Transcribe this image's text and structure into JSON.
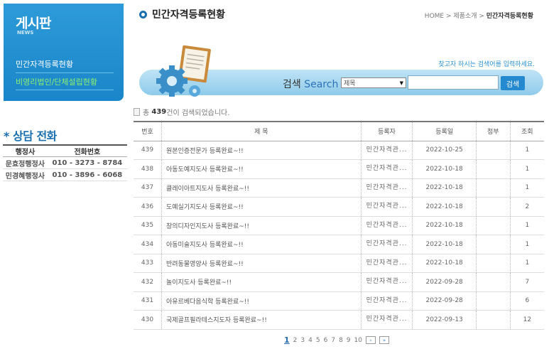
{
  "sidebar": {
    "title": "게시판",
    "subtitle": "NEWS",
    "items": [
      {
        "label": "민간자격등록현황"
      },
      {
        "label": "비영리법인/단체설립현황"
      }
    ]
  },
  "consult": {
    "title": "* 상담 전화",
    "headers": [
      "행정사",
      "전화번호"
    ],
    "rows": [
      {
        "name": "문효정행정사",
        "phone": "010 - 3273 - 8784"
      },
      {
        "name": "민경혜행정사",
        "phone": "010 - 3896 - 6068"
      }
    ]
  },
  "header": {
    "title": "민간자격등록현황",
    "breadcrumb_prefix": "HOME > 제품소개 > ",
    "breadcrumb_current": "민간자격등록현황"
  },
  "search": {
    "hint": "찾고자 하시는 검색어를 입력하세요.",
    "label_ko": "검색",
    "label_en": "Search",
    "select_value": "제목",
    "input_value": "",
    "button_label": "검색"
  },
  "result": {
    "prefix": "총",
    "count": "439",
    "suffix": "건이 검색되었습니다."
  },
  "board": {
    "headers": [
      "번호",
      "제 목",
      "등록자",
      "등록일",
      "첨부",
      "조회"
    ],
    "rows": [
      {
        "no": "439",
        "subject": "원본인증전문가 등록완료~!!",
        "author": "민간자격관...",
        "date": "2022-10-25",
        "attach": "",
        "views": "1"
      },
      {
        "no": "438",
        "subject": "아동도예지도사 등록완료~!!",
        "author": "민간자격관...",
        "date": "2022-10-18",
        "attach": "",
        "views": "1"
      },
      {
        "no": "437",
        "subject": "클레이아트지도사 등록완료~!!",
        "author": "민간자격관...",
        "date": "2022-10-18",
        "attach": "",
        "views": "1"
      },
      {
        "no": "436",
        "subject": "도예실기지도사 등록완료~!!",
        "author": "민간자격관...",
        "date": "2022-10-18",
        "attach": "",
        "views": "2"
      },
      {
        "no": "435",
        "subject": "창의디자인지도사 등록완료~!!",
        "author": "민간자격관...",
        "date": "2022-10-18",
        "attach": "",
        "views": "1"
      },
      {
        "no": "434",
        "subject": "아동미술지도사 등록완료~!!",
        "author": "민간자격관...",
        "date": "2022-10-18",
        "attach": "",
        "views": "1"
      },
      {
        "no": "433",
        "subject": "반려동물영양사 등록완료~!!",
        "author": "민간자격관...",
        "date": "2022-10-18",
        "attach": "",
        "views": "1"
      },
      {
        "no": "432",
        "subject": "놀이지도사 등록완료~!!",
        "author": "민간자격관...",
        "date": "2022-09-28",
        "attach": "",
        "views": "7"
      },
      {
        "no": "431",
        "subject": "아유르베다음식학 등록완료~!!",
        "author": "민간자격관...",
        "date": "2022-09-28",
        "attach": "",
        "views": "6"
      },
      {
        "no": "430",
        "subject": "국제골프필라테스지도자 등록완료~!!",
        "author": "민간자격관...",
        "date": "2022-09-13",
        "attach": "",
        "views": "12"
      }
    ]
  },
  "pagination": {
    "current": "1",
    "pages": [
      "2",
      "3",
      "4",
      "5",
      "6",
      "7",
      "8",
      "9",
      "10"
    ],
    "next_label": "›",
    "last_label": "»"
  },
  "colors": {
    "sidebar_bg": "#2390d3",
    "sidebar_active": "#8ff06d",
    "accent": "#1a6fae",
    "search_button": "#2589cf"
  }
}
